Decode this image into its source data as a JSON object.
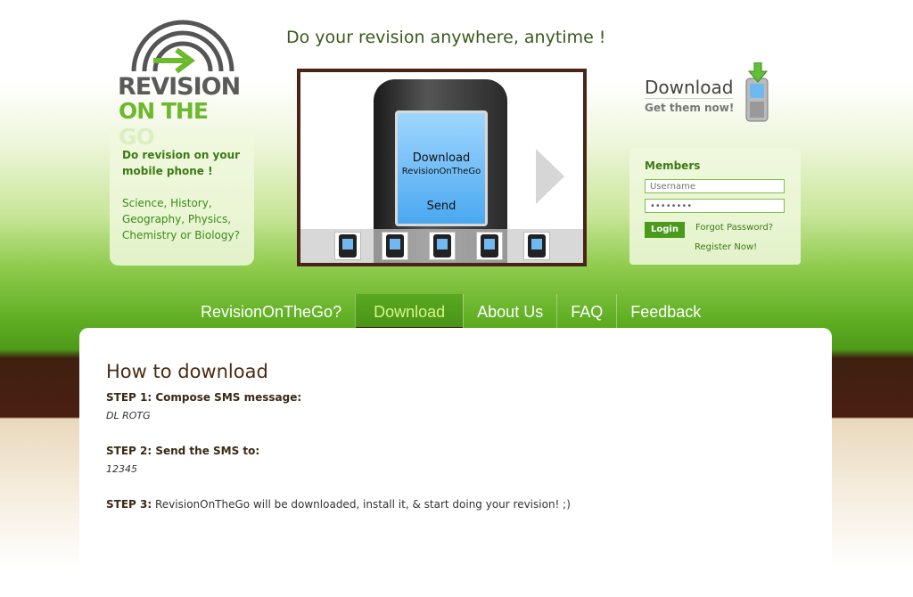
{
  "logo": {
    "line1": "REVISION",
    "line2": "ON THE GO"
  },
  "tagline": "Do your revision anywhere, anytime !",
  "promo": {
    "headline": "Do revision on your mobile phone !",
    "subjects": "Science, History, Geography, Physics, Chemistry or Biology?"
  },
  "showcase": {
    "screen_line1": "Download",
    "screen_line2": "RevisionOnTheGo",
    "screen_action": "Send",
    "thumbnail_count": 5
  },
  "download_promo": {
    "title": "Download",
    "subtitle": "Get them now!"
  },
  "members": {
    "heading": "Members",
    "username_placeholder": "Username",
    "password_value": "••••••••",
    "login_label": "Login",
    "forgot_label": "Forgot Password?",
    "register_label": "Register Now!"
  },
  "nav": {
    "items": [
      "RevisionOnTheGo?",
      "Download",
      "About Us",
      "FAQ",
      "Feedback"
    ],
    "active": "Download"
  },
  "content": {
    "title": "How to download",
    "step1_label": "STEP 1: Compose SMS message:",
    "step1_value": "DL ROTG",
    "step2_label": "STEP 2: Send the SMS to:",
    "step2_value": "12345",
    "step3_label": "STEP 3:",
    "step3_text": "RevisionOnTheGo will be downloaded, install it, & start doing your revision! ;)"
  },
  "colors": {
    "brand_green": "#6db92d",
    "brown": "#4a2416",
    "nav_active": "#d7f58a"
  }
}
